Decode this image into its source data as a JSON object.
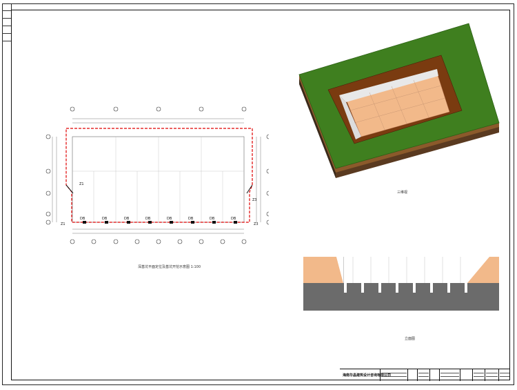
{
  "drawing": {
    "plan_title": "深基坑平面定位及基坑开挖示意图 1:100",
    "view_3d_label": "三维视",
    "elevation_label": "立面图",
    "company": "海南华晶建筑设计咨询有限公司"
  },
  "colors": {
    "grass": "#3f7f1f",
    "soil": "#7a3b10",
    "pit_floor": "#f2b98a",
    "red_dash": "#e00000",
    "asphalt": "#6b6b6b"
  }
}
